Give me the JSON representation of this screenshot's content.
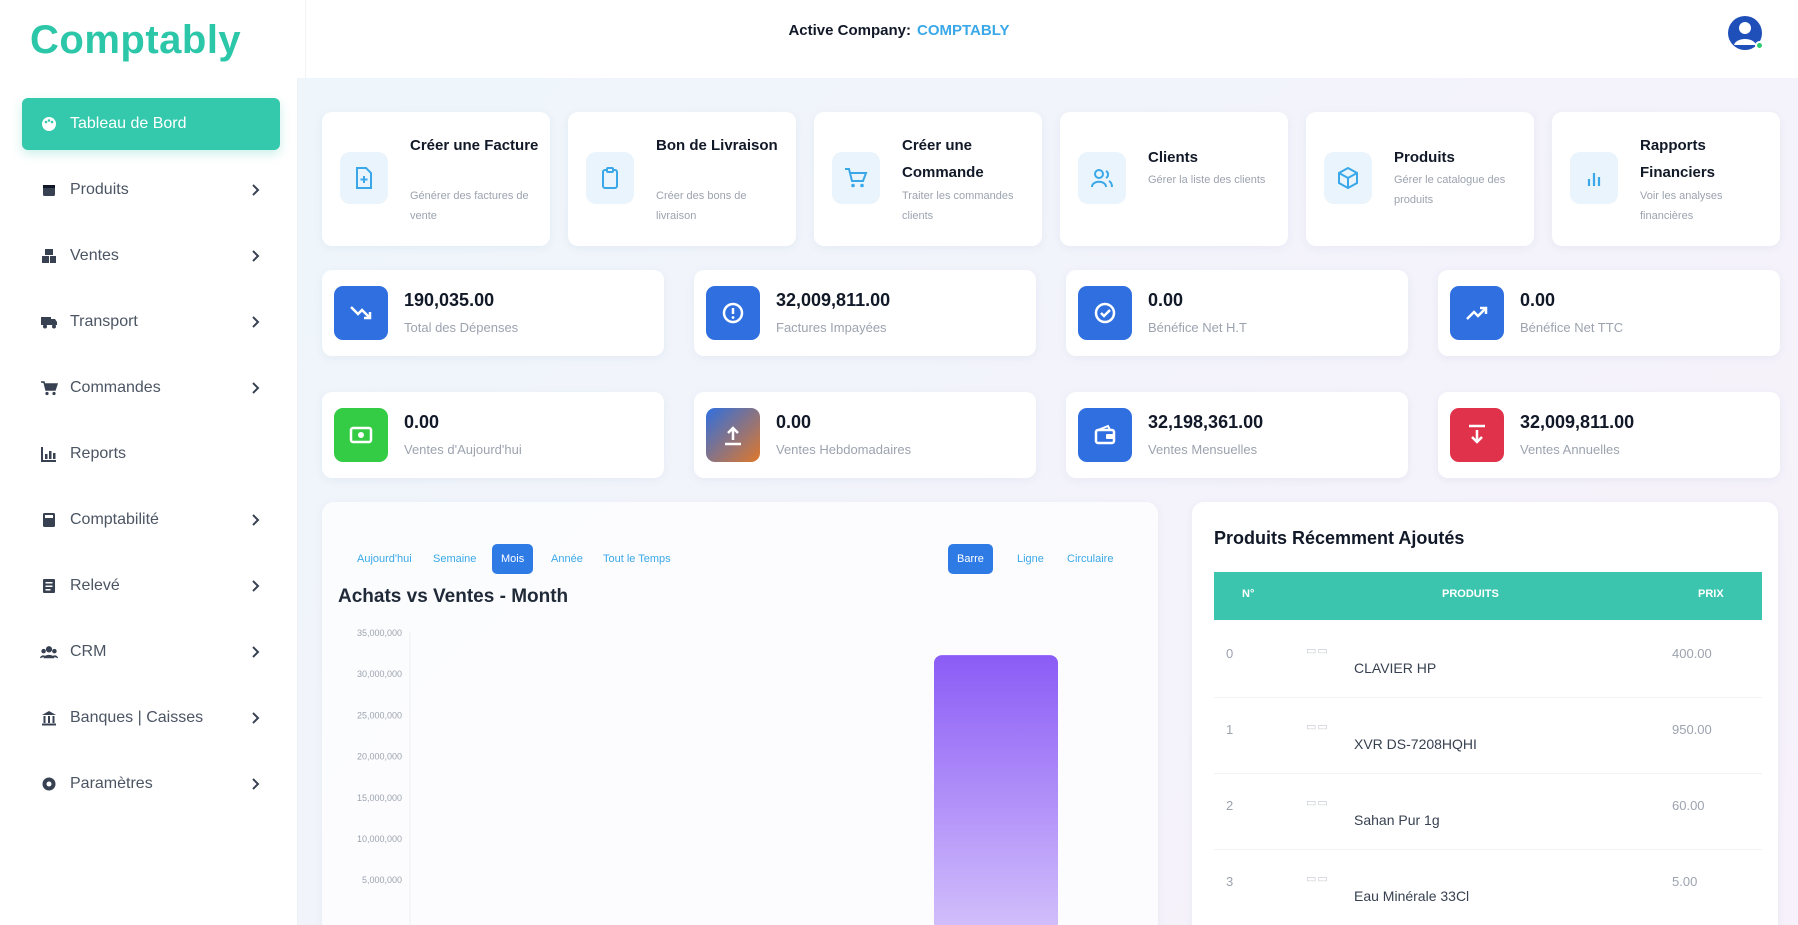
{
  "app": {
    "logo": "Comptably",
    "active_company_label": "Active Company:",
    "active_company_name": "COMPTABLY"
  },
  "sidebar": {
    "items": [
      {
        "label": "Tableau de Bord",
        "icon": "palette-icon",
        "active": true,
        "has_chevron": false
      },
      {
        "label": "Produits",
        "icon": "box-icon",
        "has_chevron": true
      },
      {
        "label": "Ventes",
        "icon": "boxes-icon",
        "has_chevron": true
      },
      {
        "label": "Transport",
        "icon": "truck-icon",
        "has_chevron": true
      },
      {
        "label": "Commandes",
        "icon": "cart-icon",
        "has_chevron": true
      },
      {
        "label": "Reports",
        "icon": "chart-icon",
        "has_chevron": false
      },
      {
        "label": "Comptabilité",
        "icon": "calculator-icon",
        "has_chevron": true
      },
      {
        "label": "Relevé",
        "icon": "document-icon",
        "has_chevron": true
      },
      {
        "label": "CRM",
        "icon": "users-icon",
        "has_chevron": true
      },
      {
        "label": "Banques | Caisses",
        "icon": "bank-icon",
        "has_chevron": true
      },
      {
        "label": "Paramètres",
        "icon": "gear-icon",
        "has_chevron": true
      }
    ]
  },
  "quick_actions": [
    {
      "title": "Créer une Facture",
      "desc": "Générer des factures de vente",
      "icon": "invoice-icon"
    },
    {
      "title": "Bon de Livraison",
      "desc": "Créer des bons de livraison",
      "icon": "clipboard-icon"
    },
    {
      "title": "Créer une Commande",
      "desc": "Traiter les commandes clients",
      "icon": "cart-icon"
    },
    {
      "title": "Clients",
      "desc": "Gérer la liste des clients",
      "icon": "users-icon"
    },
    {
      "title": "Produits",
      "desc": "Gérer le catalogue des produits",
      "icon": "cube-icon"
    },
    {
      "title": "Rapports Financiers",
      "desc": "Voir les analyses financières",
      "icon": "bar-chart-icon"
    }
  ],
  "stats_row1": [
    {
      "value": "190,035.00",
      "label": "Total des Dépenses",
      "icon": "trend-down-icon",
      "color": "#2f6fe0"
    },
    {
      "value": "32,009,811.00",
      "label": "Factures Impayées",
      "icon": "alert-icon",
      "color": "#2f6fe0"
    },
    {
      "value": "0.00",
      "label": "Bénéfice Net H.T",
      "icon": "check-badge-icon",
      "color": "#2f6fe0"
    },
    {
      "value": "0.00",
      "label": "Bénéfice Net TTC",
      "icon": "trend-up-icon",
      "color": "#2f6fe0"
    }
  ],
  "stats_row2": [
    {
      "value": "0.00",
      "label": "Ventes d'Aujourd'hui",
      "icon": "cash-icon",
      "color": "#33cc44"
    },
    {
      "value": "0.00",
      "label": "Ventes Hebdomadaires",
      "icon": "upload-icon",
      "color": "#3868b8"
    },
    {
      "value": "32,198,361.00",
      "label": "Ventes Mensuelles",
      "icon": "wallet-icon",
      "color": "#2f6fe0"
    },
    {
      "value": "32,009,811.00",
      "label": "Ventes Annuelles",
      "icon": "download-icon",
      "color": "#e0324a"
    }
  ],
  "chart_panel": {
    "period_tabs": [
      "Aujourd'hui",
      "Semaine",
      "Mois",
      "Année",
      "Tout le Temps"
    ],
    "active_period": "Mois",
    "type_tabs": [
      "Barre",
      "Ligne",
      "Circulaire"
    ],
    "active_type": "Barre",
    "title": "Achats vs Ventes - Month"
  },
  "chart_data": {
    "type": "bar",
    "title": "Achats vs Ventes - Month",
    "ylim": [
      0,
      35000000
    ],
    "y_ticks": [
      "35,000,000",
      "30,000,000",
      "25,000,000",
      "20,000,000",
      "15,000,000",
      "10,000,000",
      "5,000,000"
    ],
    "bars": [
      {
        "value": 32198361,
        "color_top": "#8b5cf6",
        "color_bottom": "#d8c7fb"
      }
    ]
  },
  "products_panel": {
    "title": "Produits Récemment Ajoutés",
    "columns": [
      "N°",
      "PRODUITS",
      "PRIX"
    ],
    "rows": [
      {
        "num": "0",
        "name": "CLAVIER HP",
        "price": "400.00"
      },
      {
        "num": "1",
        "name": "XVR DS-7208HQHI",
        "price": "950.00"
      },
      {
        "num": "2",
        "name": "Sahan Pur 1g",
        "price": "60.00"
      },
      {
        "num": "3",
        "name": "Eau Minérale 33Cl",
        "price": "5.00"
      }
    ]
  },
  "colors": {
    "brand": "#2cc6a8",
    "accent_blue": "#2f7be6",
    "link_blue": "#3aa8e8"
  }
}
